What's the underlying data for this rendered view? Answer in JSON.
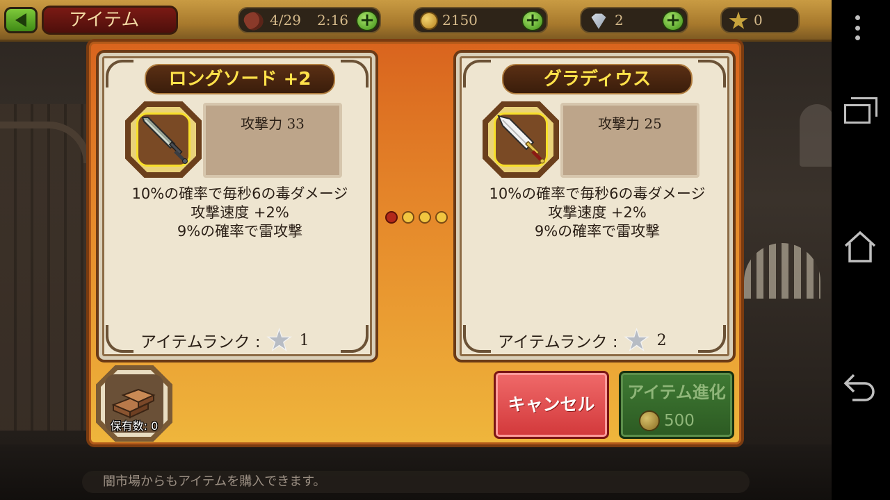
{
  "header": {
    "title": "アイテム",
    "stamina": {
      "current": "4/29",
      "timer": "2:16"
    },
    "gold": "2150",
    "gems": "2",
    "stars": "0",
    "plus_label": "+"
  },
  "dialog": {
    "items": [
      {
        "name": "ロングソード +2",
        "stat": "攻撃力 33",
        "effects": [
          "10%の確率で毎秒6の毒ダメージ",
          "攻撃速度 +2%",
          "9%の確率で雷攻撃"
        ],
        "rank_label": "アイテムランク :",
        "rank_value": "1"
      },
      {
        "name": "グラディウス",
        "stat": "攻撃力 25",
        "effects": [
          "10%の確率で毎秒6の毒ダメージ",
          "攻撃速度 +2%",
          "9%の確率で雷攻撃"
        ],
        "rank_label": "アイテムランク :",
        "rank_value": "2"
      }
    ],
    "pagination": {
      "total": 4,
      "active": 1
    },
    "material_count": "保有数: 0",
    "cancel_label": "キャンセル",
    "evolve_label": "アイテム進化",
    "evolve_cost": "500"
  },
  "tip": "闇市場からもアイテムを購入できます。",
  "colors": {
    "dialog_orange": "#e68a2b",
    "name_yellow": "#ffe24a",
    "cancel_red": "#d2383a",
    "evolve_green": "#2c5a22",
    "dot_active": "#b3281a",
    "dot_inactive": "#f2c640"
  },
  "icons": {
    "back": "back-arrow-icon",
    "stamina": "meat-icon",
    "gold": "gold-coin-icon",
    "gem": "diamond-icon",
    "star": "star-icon",
    "item1": "longsword-icon",
    "item2": "gladius-icon",
    "material": "bronze-ingot-icon"
  }
}
